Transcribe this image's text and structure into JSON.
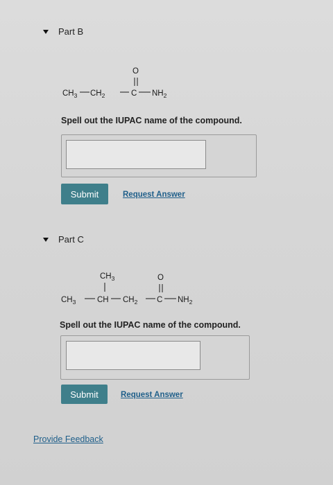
{
  "partB": {
    "title": "Part B",
    "formula": {
      "ch3": "CH",
      "sub3": "3",
      "ch2": "CH",
      "sub2": "2",
      "c": "C",
      "o": "O",
      "nh2": "NH",
      "nh2sub": "2"
    },
    "prompt": "Spell out the IUPAC name of the compound.",
    "input_value": "",
    "submit_label": "Submit",
    "request_label": "Request Answer"
  },
  "partC": {
    "title": "Part C",
    "formula": {
      "branch": "CH",
      "branchSub": "3",
      "ch3": "CH",
      "sub3": "3",
      "ch": "CH",
      "ch2": "CH",
      "sub2": "2",
      "c": "C",
      "o": "O",
      "nh2": "NH",
      "nh2sub": "2"
    },
    "prompt": "Spell out the IUPAC name of the compound.",
    "input_value": "",
    "submit_label": "Submit",
    "request_label": "Request Answer"
  },
  "feedback_label": "Provide Feedback",
  "colors": {
    "submit_bg": "#3f7f8b",
    "link": "#1f5f8a"
  }
}
